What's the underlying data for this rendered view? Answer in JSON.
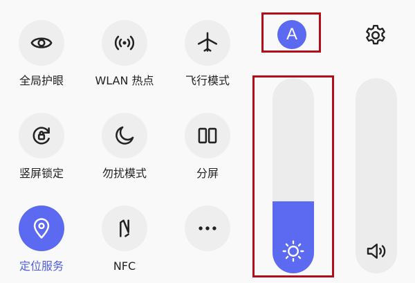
{
  "tiles": [
    {
      "label": "全局护眼",
      "icon": "eye-icon",
      "active": false
    },
    {
      "label": "WLAN 热点",
      "icon": "hotspot-icon",
      "active": false
    },
    {
      "label": "飞行模式",
      "icon": "airplane-icon",
      "active": false
    },
    {
      "label": "竖屏锁定",
      "icon": "rotation-lock-icon",
      "active": false
    },
    {
      "label": "勿扰模式",
      "icon": "moon-icon",
      "active": false
    },
    {
      "label": "分屏",
      "icon": "split-screen-icon",
      "active": false
    },
    {
      "label": "定位服务",
      "icon": "location-pin-icon",
      "active": true
    },
    {
      "label": "NFC",
      "icon": "nfc-icon",
      "active": false
    },
    {
      "label": "",
      "icon": "more-icon",
      "active": false
    }
  ],
  "auto_brightness": {
    "label": "A",
    "enabled": true
  },
  "brightness": {
    "level": 0.37,
    "icon": "sun-icon"
  },
  "volume": {
    "level": 0.0,
    "icon": "speaker-icon"
  },
  "colors": {
    "accent": "#5b6af0",
    "active_label": "#4e5ee8",
    "annotation": "#b30d1a"
  }
}
